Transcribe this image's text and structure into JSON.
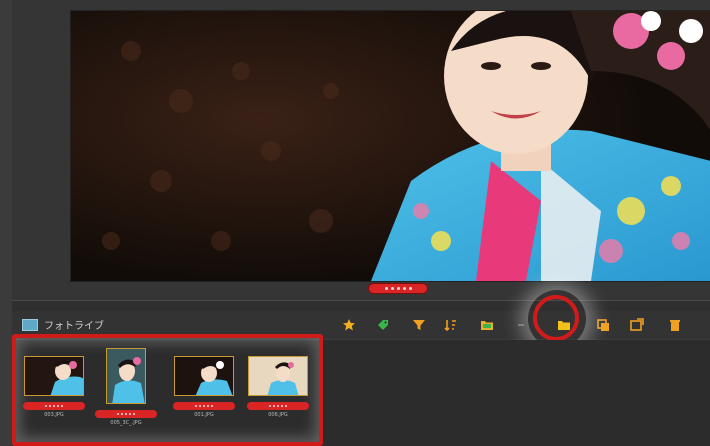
{
  "window": {
    "title": ""
  },
  "preview": {
    "image": "portrait-kimono",
    "rating_stars": 5
  },
  "collection": {
    "label": "フォトライブ"
  },
  "toolbar": {
    "icons": [
      "star-icon",
      "tag-icon",
      "filter-icon",
      "sort-icon",
      "folder-icon",
      "separator",
      "collection-add-icon",
      "copy-icon",
      "export-icon",
      "trash-icon"
    ],
    "highlighted": "collection-add-icon"
  },
  "thumbnails": [
    {
      "name": "003.JPG",
      "rating": 5
    },
    {
      "name": "005_3C_.JPG",
      "rating": 5
    },
    {
      "name": "001.JPG",
      "rating": 5
    },
    {
      "name": "006.JPG",
      "rating": 5
    }
  ],
  "colors": {
    "accent": "#d11b1b",
    "rating": "#d92525",
    "icon": "#f0b020"
  }
}
